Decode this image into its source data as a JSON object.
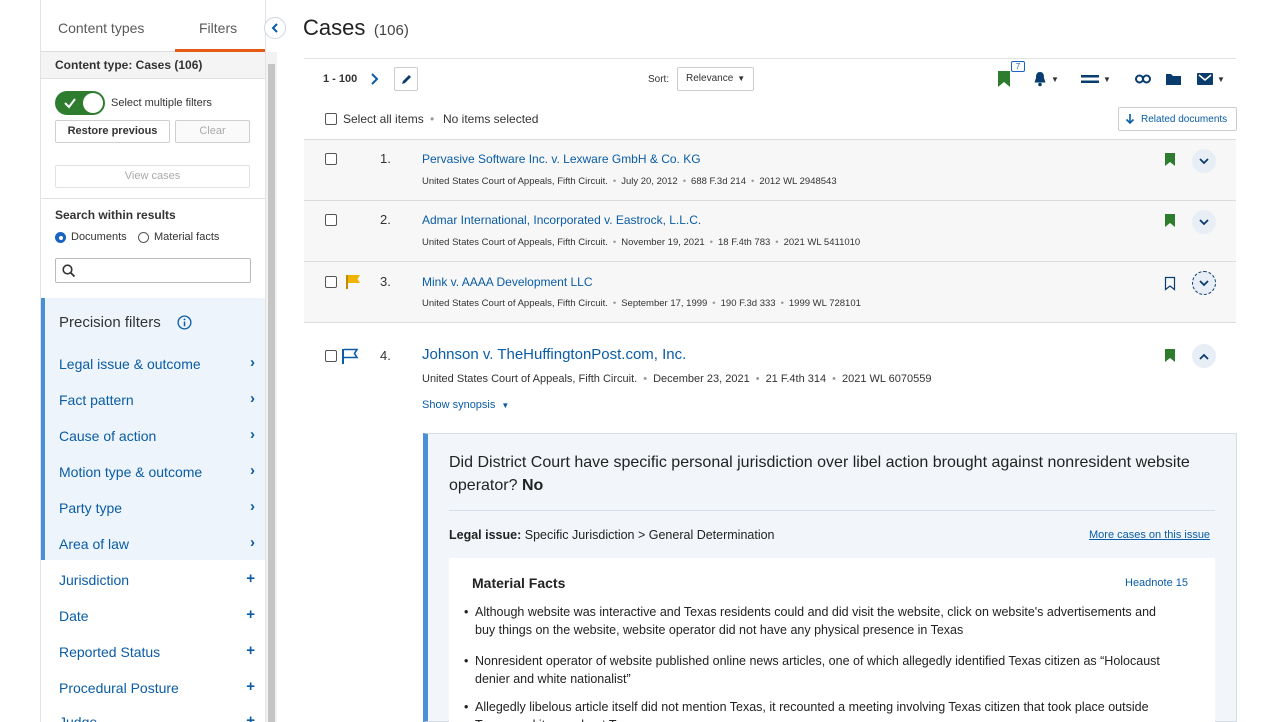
{
  "sidebar": {
    "tabs": [
      {
        "label": "Content types"
      },
      {
        "label": "Filters"
      }
    ],
    "content_type_header": "Content type: Cases (106)",
    "select_multiple_label": "Select multiple filters",
    "restore_label": "Restore previous",
    "clear_label": "Clear",
    "view_cases_label": "View cases",
    "search_within_label": "Search within results",
    "radio_documents": "Documents",
    "radio_material": "Material facts",
    "precision_title": "Precision filters",
    "precision_items": [
      {
        "label": "Legal issue & outcome"
      },
      {
        "label": "Fact pattern"
      },
      {
        "label": "Cause of action"
      },
      {
        "label": "Motion type & outcome"
      },
      {
        "label": "Party type"
      },
      {
        "label": "Area of law"
      }
    ],
    "other_items": [
      {
        "label": "Jurisdiction"
      },
      {
        "label": "Date"
      },
      {
        "label": "Reported Status"
      },
      {
        "label": "Procedural Posture"
      },
      {
        "label": "Judge"
      }
    ]
  },
  "main": {
    "title": "Cases",
    "count": "(106)",
    "range": "1 - 100",
    "sort_label": "Sort:",
    "sort_value": "Relevance",
    "bookmark_badge": "7",
    "select_all": "Select all items",
    "no_selected": "No items selected",
    "related_docs": "Related documents",
    "cases": [
      {
        "num": "1.",
        "title": "Pervasive Software Inc. v. Lexware GmbH & Co. KG",
        "court": "United States Court of Appeals, Fifth Circuit.",
        "date": "July 20, 2012",
        "reporter": "688 F.3d 214",
        "wl": "2012 WL 2948543"
      },
      {
        "num": "2.",
        "title": "Admar International, Incorporated v. Eastrock, L.L.C.",
        "court": "United States Court of Appeals, Fifth Circuit.",
        "date": "November 19, 2021",
        "reporter": "18 F.4th 783",
        "wl": "2021 WL 5411010"
      },
      {
        "num": "3.",
        "title": "Mink v. AAAA Development LLC",
        "court": "United States Court of Appeals, Fifth Circuit.",
        "date": "September 17, 1999",
        "reporter": "190 F.3d 333",
        "wl": "1999 WL 728101"
      },
      {
        "num": "4.",
        "title": "Johnson v. TheHuffingtonPost.com, Inc.",
        "court": "United States Court of Appeals, Fifth Circuit.",
        "date": "December 23, 2021",
        "reporter": "21 F.4th 314",
        "wl": "2021 WL 6070559"
      }
    ],
    "show_synopsis": "Show synopsis",
    "question_text": "Did District Court have specific personal jurisdiction over libel action brought against nonresident website operator?",
    "answer": "No",
    "legal_issue_label": "Legal issue:",
    "legal_issue_value": "Specific Jurisdiction > General Determination",
    "more_cases": "More cases on this issue",
    "material_facts_title": "Material Facts",
    "headnote": "Headnote 15",
    "facts": [
      "Although website was interactive and Texas residents could and did visit the website, click on website's advertisements and buy things on the website, website operator did not have any physical presence in Texas",
      "Nonresident operator of website published online news articles, one of which allegedly identified Texas citizen as “Holocaust denier and white nationalist”",
      "Allegedly libelous article itself did not mention Texas, it recounted a meeting involving Texas citizen that took place outside Texas, and it was about Texas"
    ]
  },
  "colors": {
    "accent_orange": "#e55b13",
    "link_blue": "#0a5ca6",
    "green": "#2e7d2e",
    "flag_yellow": "#f0b400"
  }
}
